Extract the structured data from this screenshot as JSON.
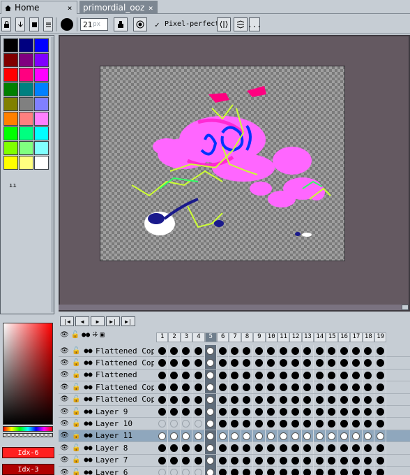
{
  "tabs": [
    {
      "label": "Home",
      "close": "×"
    },
    {
      "label": "primordial_ooz",
      "close": "×"
    }
  ],
  "toolbar": {
    "brush_size": "21",
    "brush_unit": "px",
    "pixel_perfect_check": "✓",
    "pixel_perfect_label": "Pixel-perfect",
    "more": "..."
  },
  "palette": {
    "colors": [
      "#000000",
      "#000080",
      "#0000ff",
      "#800000",
      "#800080",
      "#8000ff",
      "#ff0000",
      "#ff0080",
      "#ff00ff",
      "#008000",
      "#008080",
      "#0080ff",
      "#808000",
      "#808080",
      "#8080ff",
      "#ff8000",
      "#ff8080",
      "#ff80ff",
      "#00ff00",
      "#00ff80",
      "#00ffff",
      "#80ff00",
      "#80ff80",
      "#80ffff",
      "#ffff00",
      "#ffff80",
      "#ffffff"
    ]
  },
  "color_picker": {
    "fg_index": "Idx-6",
    "bg_index": "Idx-3"
  },
  "timeline": {
    "frames": [
      "1",
      "2",
      "3",
      "4",
      "5",
      "6",
      "7",
      "8",
      "9",
      "10",
      "11",
      "12",
      "13",
      "14",
      "15",
      "16",
      "17",
      "18",
      "19"
    ],
    "active_frame": "5",
    "layers": [
      {
        "name": "Flattened Cop",
        "cels": "filled"
      },
      {
        "name": "Flattened Cop",
        "cels": "filled"
      },
      {
        "name": "Flattened",
        "cels": "filled"
      },
      {
        "name": "Flattened Cop",
        "cels": "filled"
      },
      {
        "name": "Flattened Cop",
        "cels": "filled"
      },
      {
        "name": "Layer 9",
        "cels": "filled"
      },
      {
        "name": "Layer 10",
        "cels": "mixed"
      },
      {
        "name": "Layer 11",
        "cels": "white",
        "selected": true
      },
      {
        "name": "Layer 8",
        "cels": "filled"
      },
      {
        "name": "Layer 7",
        "cels": "filled"
      },
      {
        "name": "Layer 6",
        "cels": "mixed"
      }
    ]
  },
  "colors": {
    "canvas_bg": "#645961",
    "ui_bg": "#c6cdd4",
    "selected_row": "#8fa7bd",
    "index_fg": "#ff2020",
    "index_bg": "#b00000"
  }
}
